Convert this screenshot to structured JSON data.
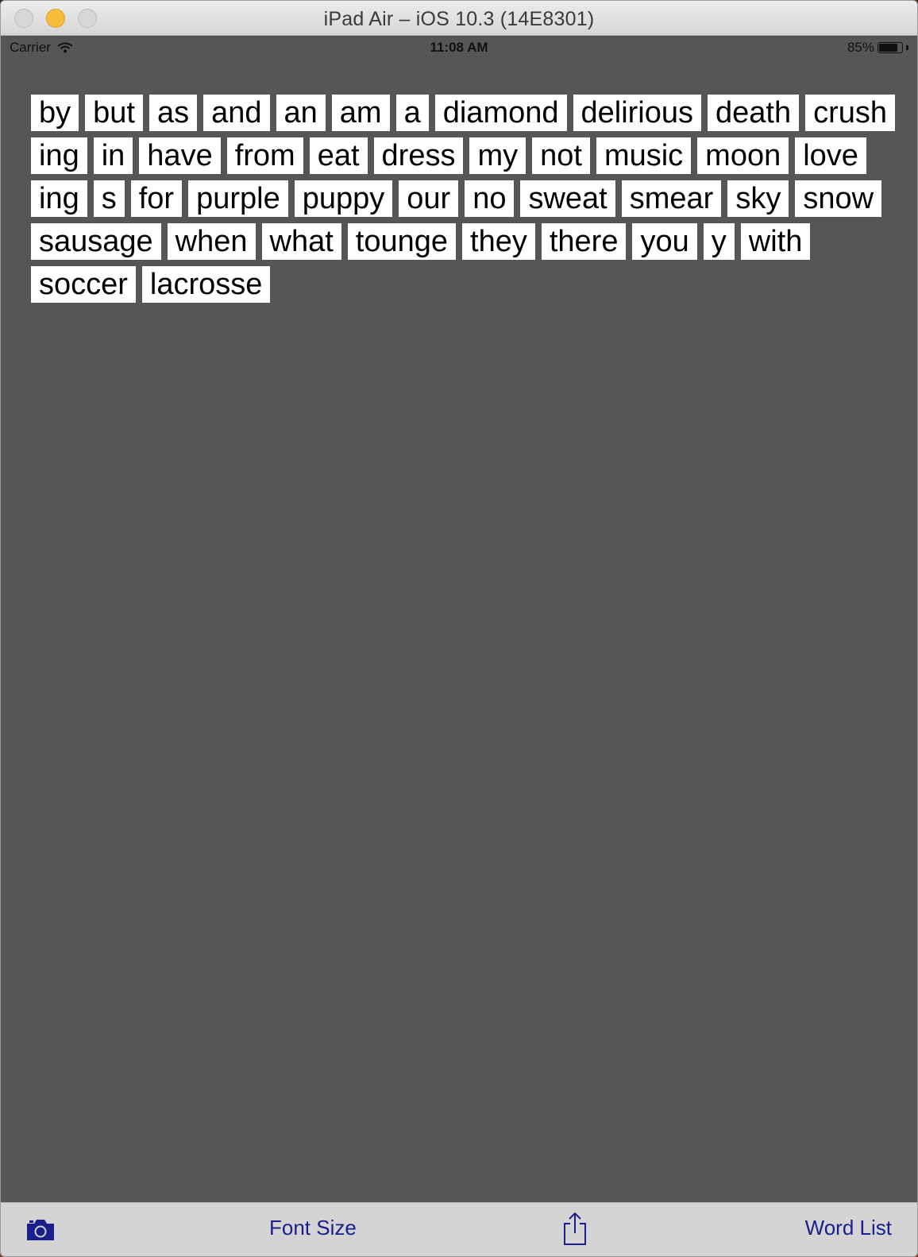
{
  "window": {
    "title": "iPad Air – iOS 10.3 (14E8301)"
  },
  "status_bar": {
    "carrier": "Carrier",
    "time": "11:08 AM",
    "battery": "85%",
    "battery_level": 0.85
  },
  "words": [
    "by",
    "but",
    "as",
    "and",
    "an",
    "am",
    "a",
    "diamond",
    "delirious",
    "death",
    "crush",
    "ing",
    "in",
    "have",
    "from",
    "eat",
    "dress",
    "my",
    "not",
    "music",
    "moon",
    "love",
    "ing",
    "s",
    "for",
    "purple",
    "puppy",
    "our",
    "no",
    "sweat",
    "smear",
    "sky",
    "snow",
    "sausage",
    "when",
    "what",
    "tounge",
    "they",
    "there",
    "you",
    "y",
    "with",
    "soccer",
    "lacrosse"
  ],
  "toolbar": {
    "camera_icon": "camera-icon",
    "font_size_label": "Font Size",
    "share_icon": "share-icon",
    "word_list_label": "Word List"
  },
  "colors": {
    "canvas": "#565656",
    "tile": "#ffffff",
    "toolbar_tint": "#1a1f8c",
    "toolbar_bg": "#d4d4d4"
  }
}
